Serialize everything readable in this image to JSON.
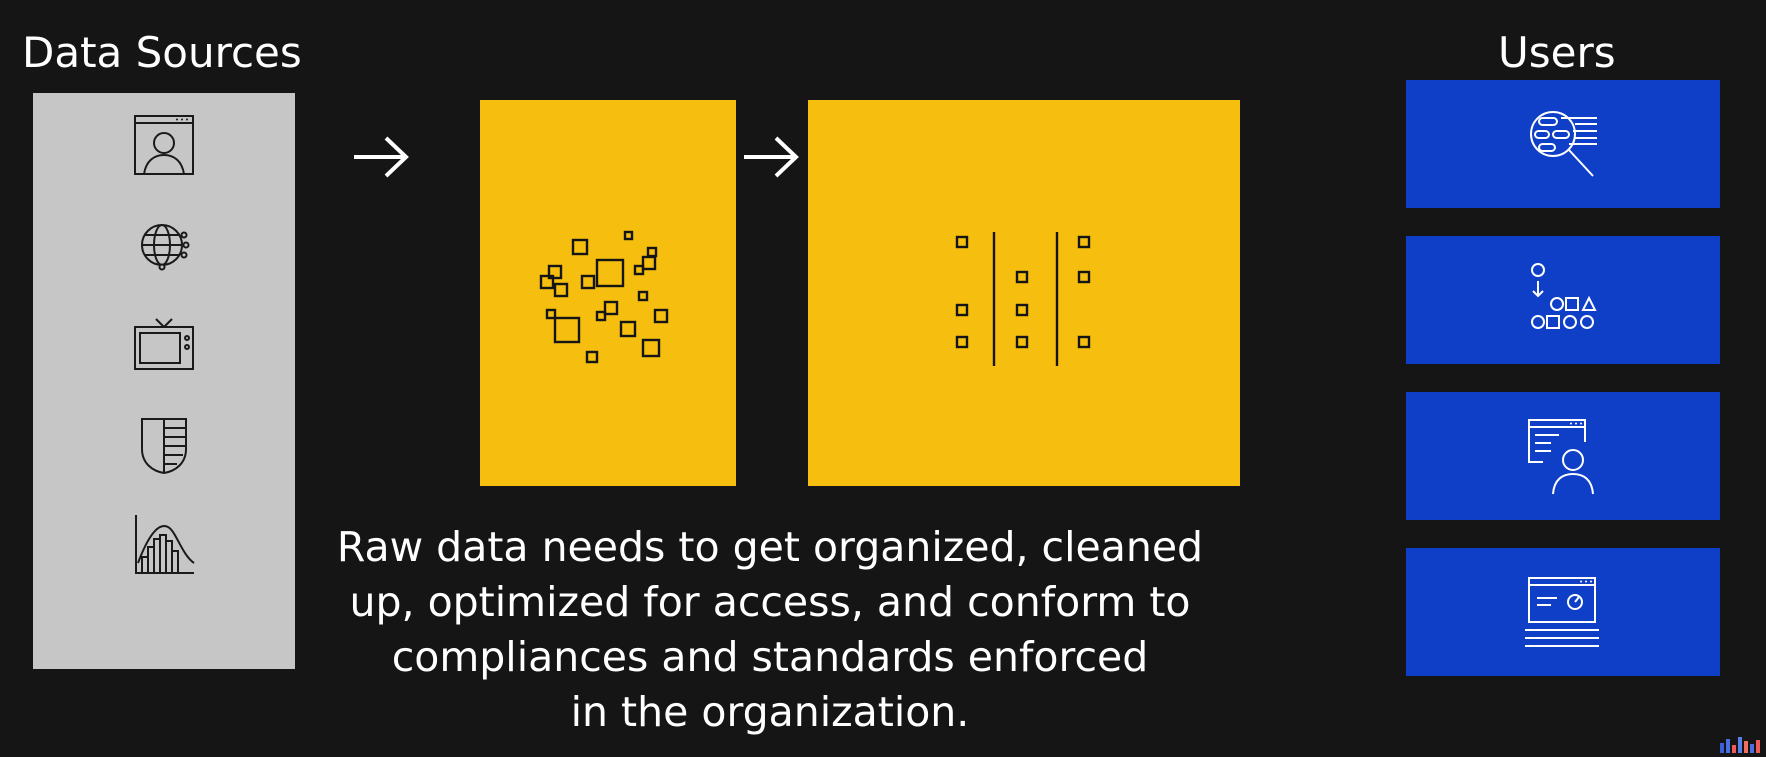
{
  "headings": {
    "data_sources": "Data Sources",
    "users": "Users"
  },
  "caption": {
    "lines": [
      "Raw data needs to get organized, cleaned",
      "up, optimized for access, and conform to",
      "compliances and standards enforced",
      "in the organization."
    ]
  },
  "data_sources": {
    "icons": [
      "user-profile-icon",
      "globe-network-icon",
      "television-icon",
      "shield-icon",
      "histogram-chart-icon"
    ]
  },
  "flow": {
    "stages": [
      "raw-data",
      "organized-data"
    ],
    "arrows": [
      "arrow-right-icon",
      "arrow-right-icon"
    ]
  },
  "users": {
    "icons": [
      "data-search-icon",
      "data-classify-icon",
      "user-dashboard-icon",
      "report-dashboard-icon"
    ]
  },
  "colors": {
    "background": "#151515",
    "sources_panel": "#c6c6c6",
    "stage_fill": "#f6bf10",
    "user_card": "#0f3fc7",
    "text": "#ffffff",
    "icon_dark": "#1a1a1a"
  }
}
